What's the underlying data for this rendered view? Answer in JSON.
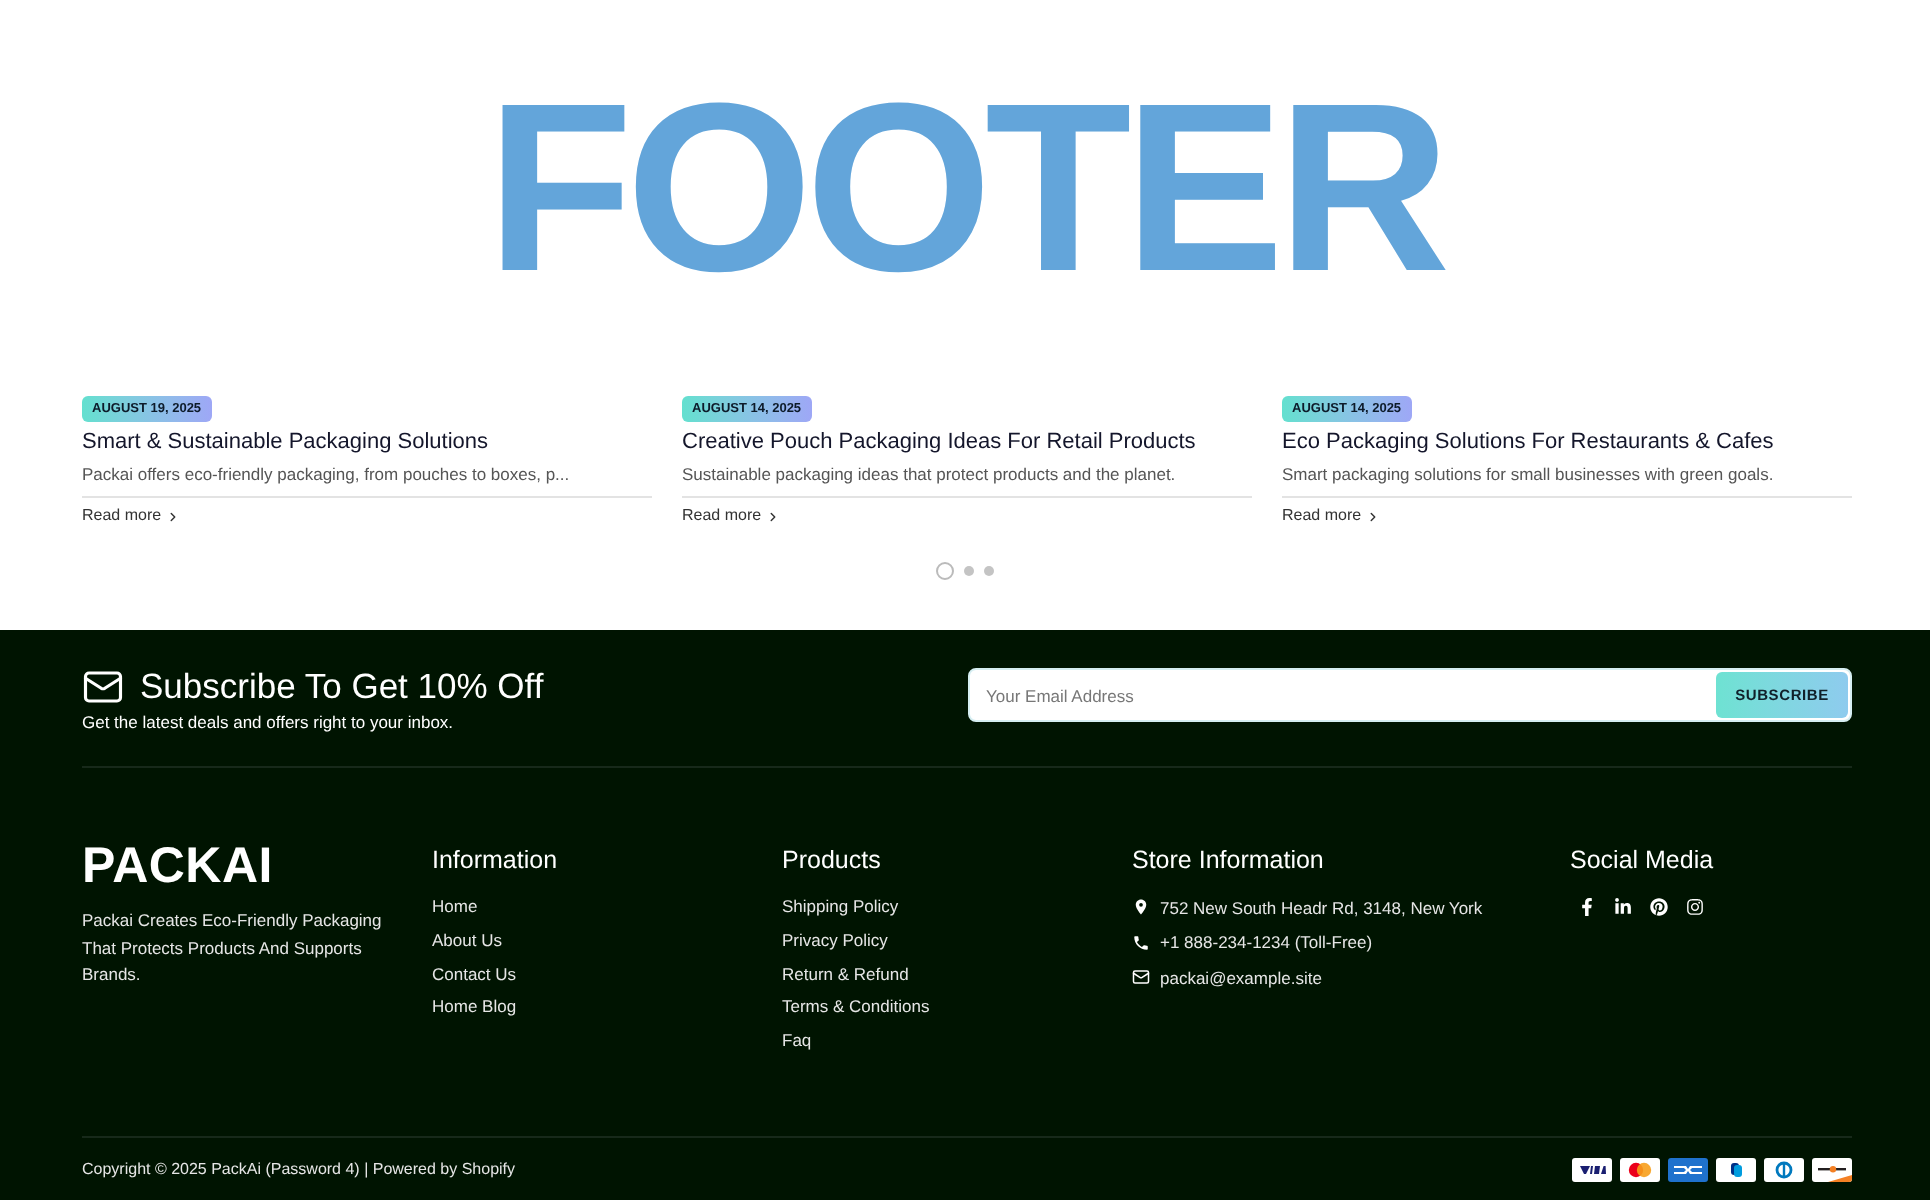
{
  "hero": {
    "title": "FOOTER"
  },
  "posts": [
    {
      "date": "AUGUST 19, 2025",
      "title": "Smart & Sustainable Packaging Solutions",
      "excerpt": "Packai offers eco-friendly packaging, from pouches to boxes, p...",
      "link": "Read more"
    },
    {
      "date": "AUGUST 14, 2025",
      "title": "Creative Pouch Packaging Ideas For Retail Products",
      "excerpt": "Sustainable packaging ideas that protect products and the planet.",
      "link": "Read more"
    },
    {
      "date": "AUGUST 14, 2025",
      "title": "Eco Packaging Solutions For Restaurants & Cafes",
      "excerpt": "Smart packaging solutions for small businesses with green goals.",
      "link": "Read more"
    }
  ],
  "carousel_dots": [
    {
      "selected": true
    },
    {
      "selected": false
    },
    {
      "selected": false
    }
  ],
  "newsletter": {
    "title": "Subscribe To Get 10% Off",
    "subtitle": "Get the latest deals and offers right to your inbox.",
    "email": {
      "placeholder": "Your Email Address"
    },
    "button": "SUBSCRIBE"
  },
  "brand": {
    "logo": "PACKAI",
    "description": "Packai Creates Eco-Friendly Packaging That Protects Products And Supports Brands."
  },
  "columns": [
    {
      "heading": "Information",
      "links": [
        "Home",
        "About Us",
        "Contact Us",
        "Home Blog"
      ]
    },
    {
      "heading": "Products",
      "links": [
        "Shipping Policy",
        "Privacy Policy",
        "Return & Refund",
        "Terms & Conditions",
        "Faq"
      ]
    }
  ],
  "store_info": {
    "heading": "Store Information",
    "items": [
      {
        "kind": "address",
        "text": "752 New South Headr Rd, 3148, New York"
      },
      {
        "kind": "phone",
        "text": "+1 888-234-1234 (Toll-Free)"
      },
      {
        "kind": "email",
        "text": "packai@example.site"
      }
    ]
  },
  "social": {
    "heading": "Social Media"
  },
  "copyright": "Copyright © 2025 PackAi (Password 4) | Powered by Shopify"
}
